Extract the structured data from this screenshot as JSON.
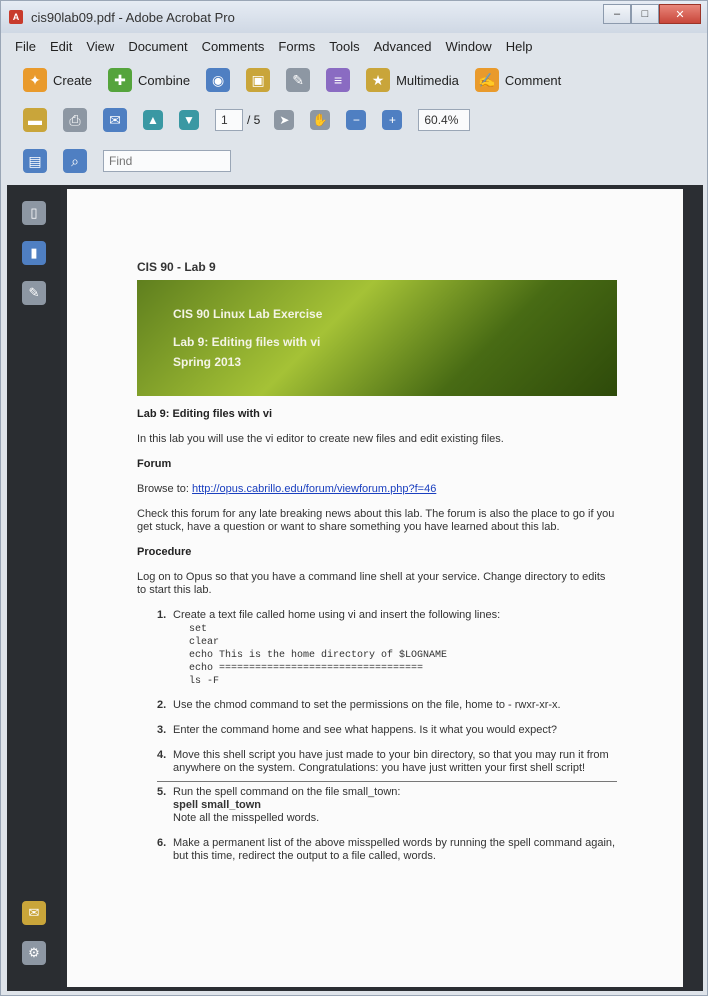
{
  "window": {
    "title": "cis90lab09.pdf - Adobe Acrobat Pro",
    "buttons": {
      "minimize": "–",
      "maximize": "□",
      "close": "✕"
    }
  },
  "menu": [
    "File",
    "Edit",
    "View",
    "Document",
    "Comments",
    "Forms",
    "Tools",
    "Advanced",
    "Window",
    "Help"
  ],
  "toolbar1": {
    "create": "Create",
    "combine": "Combine",
    "multimedia": "Multimedia",
    "comment": "Comment"
  },
  "toolbar2": {
    "page_number": "1",
    "page_total": "/ 5",
    "zoom": "60.4%"
  },
  "toolbar3": {
    "find_placeholder": "Find"
  },
  "document": {
    "banner_caption": "CIS 90 - Lab 9",
    "banner": {
      "line1": "CIS 90 Linux Lab Exercise",
      "line2": "Lab 9: Editing files with vi",
      "line3": "Spring 2013"
    },
    "heading": "Lab 9: Editing files with vi",
    "intro": "In this lab you will use the vi editor to create new files and edit existing files.",
    "forum_heading": "Forum",
    "browse_label": "Browse to: ",
    "forum_url": "http://opus.cabrillo.edu/forum/viewforum.php?f=46",
    "forum_text": "Check this forum for any late breaking news about this lab. The forum is also the place to go if you get stuck, have a question or want to share something you have learned about this lab.",
    "procedure_heading": "Procedure",
    "procedure_text": "Log on to Opus so that you have a command line shell at your service. Change directory to edits to start this lab.",
    "steps": [
      {
        "num": "1.",
        "text": "Create a text file called home using vi and insert the following lines:"
      },
      {
        "num": "2.",
        "text": "Use the chmod command to set the permissions on the file, home to - rwxr-xr-x."
      },
      {
        "num": "3.",
        "text": "Enter the command home and see what happens. Is it what you would expect?"
      },
      {
        "num": "4.",
        "text": "Move this shell script you have just made to your bin directory, so that you may run it from anywhere on the system. Congratulations: you have just written your first shell script!"
      },
      {
        "num": "5.",
        "text": "Run the spell command on the file small_town:"
      },
      {
        "num": "6.",
        "text": "Make a permanent list of the above misspelled words by running the spell command again, but this time, redirect the output to a file called, words."
      }
    ],
    "code_lines": [
      "set",
      "clear",
      "echo This is the home directory of $LOGNAME",
      "echo ==================================",
      "ls -F"
    ],
    "step5_code": "spell small_town",
    "step5_note": "Note all the misspelled words."
  }
}
